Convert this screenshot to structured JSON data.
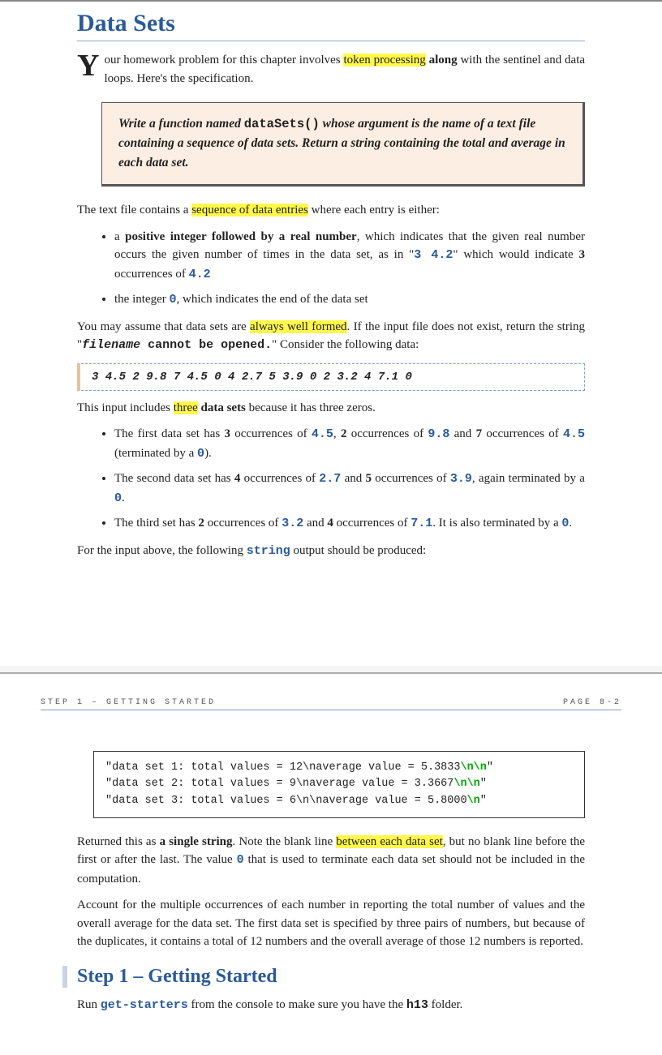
{
  "title": "Data Sets",
  "intro_drop": "Y",
  "intro_rest_1": "our homework problem for this chapter involves ",
  "intro_hl1": "token processing",
  "intro_rest_2": " ",
  "intro_bold1": "along",
  "intro_rest_3": " with the sentinel and data loops. Here's the specification.",
  "inset_1": "Write a function named ",
  "inset_code": "dataSets()",
  "inset_2": " whose argument is the name of a text file containing a sequence of data sets. Return a string containing the total and average in each data set.",
  "p1a": "The text file contains a ",
  "p1hl": "sequence of data entries",
  "p1b": " where each entry is either:",
  "li1a": "a ",
  "li1b": "positive integer followed by a real number",
  "li1c": ", which indicates that the given real number occurs the given number of times in the data set, as in \"",
  "li1code1": "3 4.2",
  "li1d": "\" which would indicate ",
  "li1bold3": "3",
  "li1e": " occurrences of ",
  "li1code2": "4.2",
  "li2a": "the integer ",
  "li2code": "0",
  "li2b": ", which indicates the end of the data set",
  "p2a": "You may assume that data sets are ",
  "p2hl": "always well formed",
  "p2b": ". If the input file does not exist, return the string \"",
  "p2code1": "filename",
  "p2code2": " cannot be opened.",
  "p2c": "\" Consider the following data:",
  "datablock": "3 4.5 2 9.8 7 4.5 0 4 2.7 5 3.9 0 2 3.2 4 7.1 0",
  "p3a": "This input includes ",
  "p3hl": "three",
  "p3b": " ",
  "p3bold": "data sets",
  "p3c": " because it has three zeros.",
  "li3a": "The first data set has ",
  "li3_3": "3",
  "li3b": " occurrences of ",
  "li3c1": "4.5",
  "li3c": ", ",
  "li3_2": "2",
  "li3d": " occurrences of ",
  "li3c2": "9.8",
  "li3e": " and ",
  "li3_7": "7",
  "li3f": " occurrences of ",
  "li3c3": "4.5",
  "li3g": " (terminated by a ",
  "li3c4": "0",
  "li3h": ").",
  "li4a": "The second data set has ",
  "li4_4": "4",
  "li4b": " occurrences of ",
  "li4c1": "2.7",
  "li4c": " and ",
  "li4_5": "5",
  "li4d": " occurrences of ",
  "li4c2": "3.9",
  "li4e": ", again terminated by a ",
  "li4c3": "0",
  "li4f": ".",
  "li5a": "The third set has ",
  "li5_2": "2",
  "li5b": " occurrences of ",
  "li5c1": "3.2",
  "li5c": " and ",
  "li5_4": "4",
  "li5d": " occurrences of ",
  "li5c2": "7.1",
  "li5e": ". It is also terminated by a ",
  "li5c3": "0",
  "li5f": ".",
  "p4a": "For the input above, the following ",
  "p4code": "string",
  "p4b": " output should be produced:",
  "hdr_left": "STEP 1 – GETTING STARTED",
  "hdr_right": "PAGE 8-2",
  "out1a": "\"data set 1: total values = 12\\naverage value = 5.3833",
  "out1n": "\\n\\n",
  "out1b": "\"",
  "out2a": "\"data set 2: total values = 9\\naverage value = 3.3667",
  "out2n": "\\n\\n",
  "out2b": "\"",
  "out3a": "\"data set 3: total values = 6\\n\\naverage value = 5.8000",
  "out3n": "\\n",
  "out3b": "\"",
  "p5a": "Returned this as ",
  "p5bold": "a single string",
  "p5b": ". Note the blank line ",
  "p5hl": "between each data set",
  "p5c": ", but no blank line before the first or after the last. The value ",
  "p5code": "0",
  "p5d": " that is used to terminate each data set should not be included in the computation.",
  "p6": "Account for the multiple occurrences of each number in reporting the total number of values and the overall average for the data set.  The first data set is specified by three pairs of numbers, but because of the duplicates, it contains a total of 12 numbers and the overall average of those 12 numbers is reported.",
  "step1": "Step 1 – Getting Started",
  "p7a": "Run ",
  "p7code": "get-starters",
  "p7b": "  from the console to make sure you have the ",
  "p7code2": "h13",
  "p7c": " folder."
}
